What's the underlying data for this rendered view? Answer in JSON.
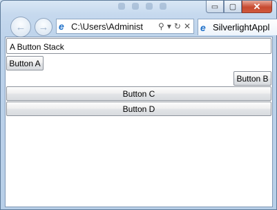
{
  "browser": {
    "address": "C:\\Users\\Administ",
    "tab_title": "SilverlightAppl",
    "caption": {
      "minimize": "▭",
      "maximize": "▢",
      "close": "✕"
    },
    "nav": {
      "back": "←",
      "forward": "→"
    },
    "address_tools": {
      "search": "⚲",
      "dropdown": "▾",
      "refresh": "↻",
      "stop": "✕"
    }
  },
  "app": {
    "title": "A Button Stack",
    "buttons": {
      "a": "Button A",
      "b": "Button B",
      "c": "Button C",
      "d": "Button D"
    }
  },
  "colors": {
    "frame": "#bcd2ea",
    "close": "#c74a30",
    "ie_blue": "#1d6fc9"
  }
}
